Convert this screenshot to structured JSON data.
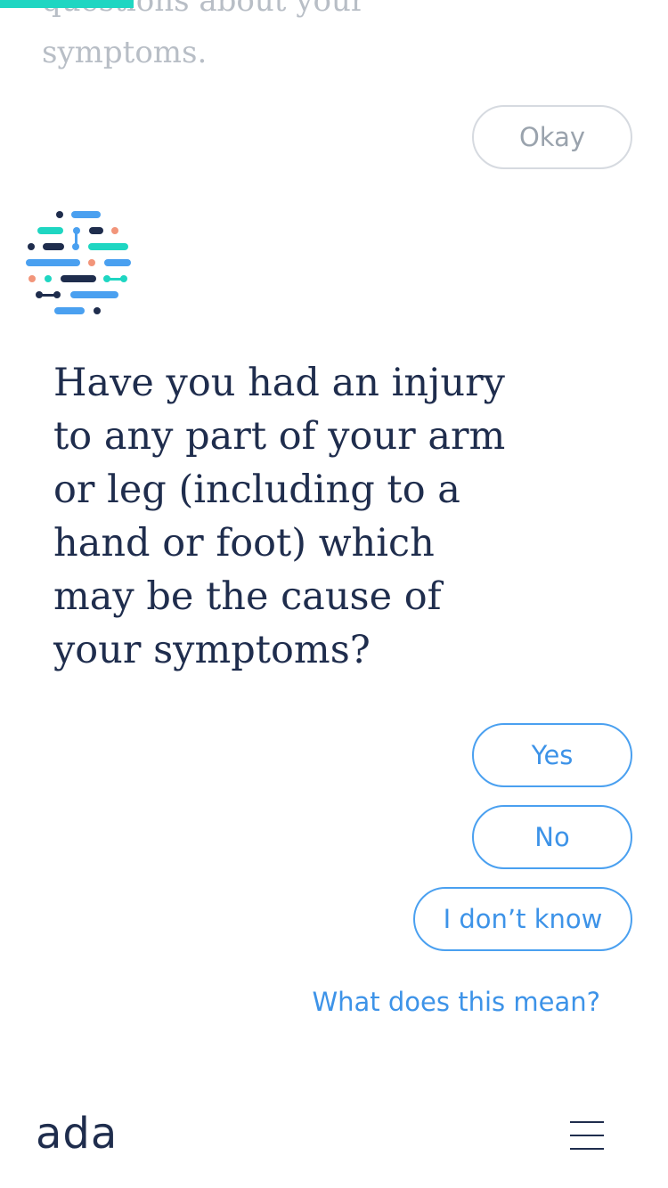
{
  "progress": 0.2,
  "colors": {
    "accent": "#1fd6c2",
    "button_blue": "#4aa0f0",
    "text_dark": "#1f2d4d",
    "text_muted": "#b8bec6"
  },
  "previous_message": "questions about your symptoms.",
  "okay_label": "Okay",
  "question": "Have you had an injury to any part of your arm or leg (including to a hand or foot) which may be the cause of your symptoms?",
  "answers": {
    "yes": "Yes",
    "no": "No",
    "dont_know": "I don’t know"
  },
  "help_link": "What does this mean?",
  "footer": {
    "brand": "ada",
    "menu_icon": "hamburger-menu-icon"
  },
  "icons": {
    "assistant_logo": "ada-dots-logo-icon"
  }
}
